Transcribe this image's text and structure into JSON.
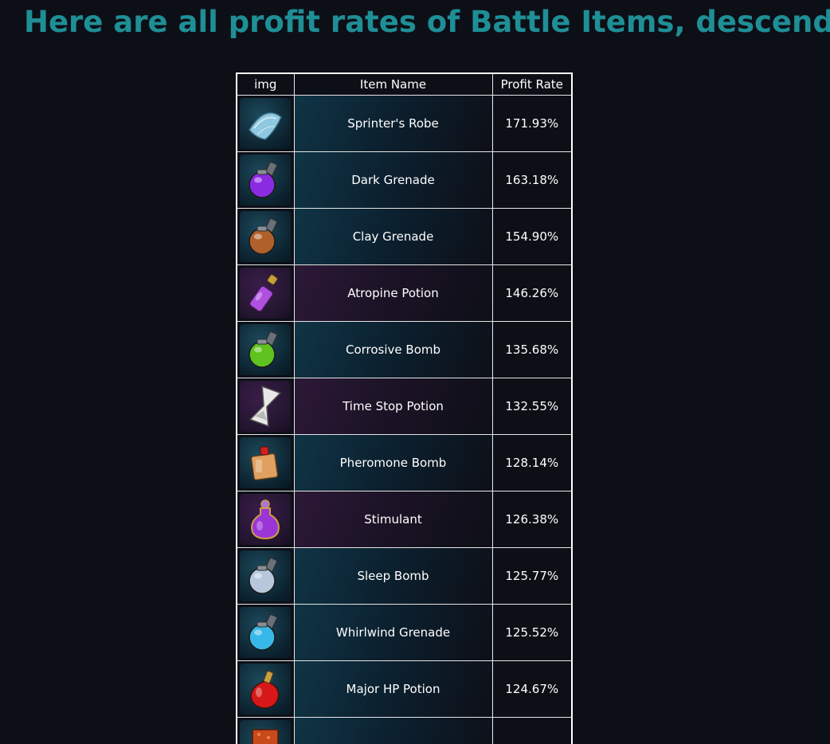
{
  "page": {
    "title": "Here are all profit rates of Battle Items, descendingly."
  },
  "table": {
    "headers": {
      "img": "img",
      "name": "Item Name",
      "rate": "Profit Rate"
    },
    "rows": [
      {
        "name": "Sprinter's Robe",
        "rate": "171.93%",
        "icon": "robe-icon",
        "bg": "blue",
        "color": "#8fc8e0"
      },
      {
        "name": "Dark Grenade",
        "rate": "163.18%",
        "icon": "grenade-icon",
        "bg": "blue",
        "color": "#8a2be2"
      },
      {
        "name": "Clay Grenade",
        "rate": "154.90%",
        "icon": "grenade-icon",
        "bg": "blue",
        "color": "#b0602a"
      },
      {
        "name": "Atropine Potion",
        "rate": "146.26%",
        "icon": "potion-icon",
        "bg": "purple",
        "color": "#b04fe0"
      },
      {
        "name": "Corrosive Bomb",
        "rate": "135.68%",
        "icon": "grenade-icon",
        "bg": "blue",
        "color": "#5fc21f"
      },
      {
        "name": "Time Stop Potion",
        "rate": "132.55%",
        "icon": "hourglass-icon",
        "bg": "purple",
        "color": "#e8e8e8"
      },
      {
        "name": "Pheromone Bomb",
        "rate": "128.14%",
        "icon": "bottle-icon",
        "bg": "blue",
        "color": "#e0a060"
      },
      {
        "name": "Stimulant",
        "rate": "126.38%",
        "icon": "flask-icon",
        "bg": "purple",
        "color": "#9a35d8"
      },
      {
        "name": "Sleep Bomb",
        "rate": "125.77%",
        "icon": "grenade-icon",
        "bg": "blue",
        "color": "#b8c8dc"
      },
      {
        "name": "Whirlwind Grenade",
        "rate": "125.52%",
        "icon": "grenade-icon",
        "bg": "blue",
        "color": "#38b8e8"
      },
      {
        "name": "Major HP Potion",
        "rate": "124.67%",
        "icon": "hp-potion-icon",
        "bg": "blue",
        "color": "#d81818"
      },
      {
        "name": "",
        "rate": "",
        "icon": "item-icon",
        "bg": "blue",
        "color": "#c84a1a"
      }
    ]
  }
}
